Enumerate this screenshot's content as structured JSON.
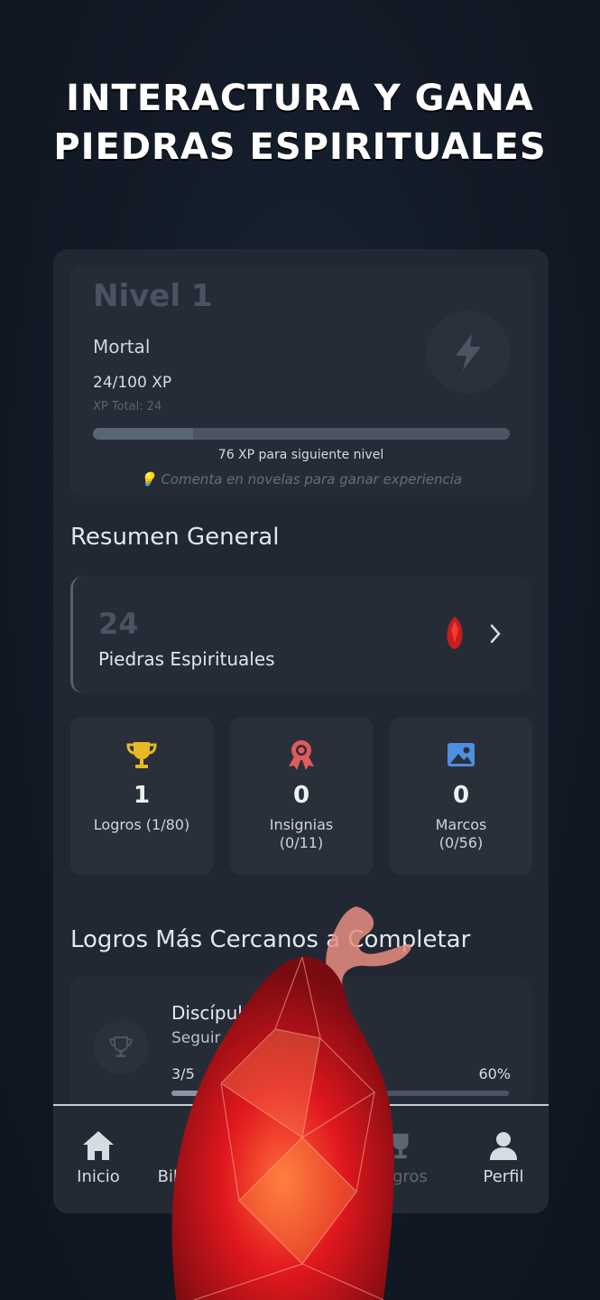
{
  "headline": {
    "line1": "INTERACTURA Y GANA",
    "line2": "PIEDRAS ESPIRITUALES"
  },
  "level": {
    "title": "Nivel 1",
    "rank": "Mortal",
    "xp": "24/100 XP",
    "xp_total": "XP Total: 24",
    "progress": 0.24,
    "next_level": "76 XP para siguiente nivel",
    "tip": "💡 Comenta en novelas para ganar experiencia",
    "icon": "lightning-bolt-icon"
  },
  "summary": {
    "title": "Resumen General",
    "stones": {
      "count": "24",
      "label": "Piedras Espirituales"
    },
    "stats": [
      {
        "icon": "trophy-icon",
        "value": "1",
        "label": "Logros (1/80)",
        "color": "#e8b923"
      },
      {
        "icon": "badge-icon",
        "value": "0",
        "label": "Insignias\n(0/11)",
        "color": "#e25a5a"
      },
      {
        "icon": "image-frame-icon",
        "value": "0",
        "label": "Marcos\n(0/56)",
        "color": "#4f8fe0"
      }
    ]
  },
  "nearest": {
    "title": "Logros Más Cercanos a Completar",
    "item": {
      "title": "Discípulo",
      "subtitle": "Seguir",
      "count": "3/5",
      "percent": "60%",
      "progress": 0.6
    }
  },
  "nav": [
    {
      "label": "Inicio",
      "icon": "home-icon",
      "active": true
    },
    {
      "label": "Biblioteca",
      "icon": "library-icon",
      "active": false
    },
    {
      "label": "",
      "icon": "center-icon",
      "active": false
    },
    {
      "label": "Logros",
      "icon": "trophy-icon",
      "active": false
    },
    {
      "label": "Perfil",
      "icon": "user-icon",
      "active": true
    }
  ]
}
